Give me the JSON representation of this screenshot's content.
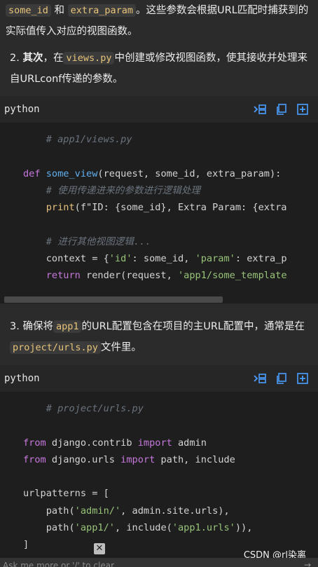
{
  "paragraph_top": {
    "code1": "some_id",
    "and": "和",
    "code2": "extra_param",
    "rest": "。这些参数会根据URL匹配时捕获到的实际值传入对应的视图函数。"
  },
  "step2": {
    "number": "2.",
    "bold": "其次",
    "text1": "，在",
    "code": "views.py",
    "text2": "中创建或修改视图函数，使其接收并处理来自URLconf传递的参数。"
  },
  "code_block_1": {
    "language": "python",
    "lines": {
      "l1": "# app1/views.py",
      "l3_kw": "def",
      "l3_fn": "some_view",
      "l3_rest": "(request, some_id, extra_param):",
      "l4": "# 使用传递进来的参数进行逻辑处理",
      "l5_fn": "print",
      "l5_rest": "(f\"ID: {some_id}, Extra Param: {extra",
      "l7": "# 进行其他视图逻辑...",
      "l8_a": "context = {",
      "l8_s1": "'id'",
      "l8_b": ": some_id, ",
      "l8_s2": "'param'",
      "l8_c": ": extra_p",
      "l9_kw": "return",
      "l9_a": " render(request, ",
      "l9_s": "'app1/some_template"
    }
  },
  "step3": {
    "number": "3.",
    "text1": "确保将",
    "code1": "app1",
    "text2": "的URL配置包含在项目的主URL配置中，通常是在",
    "code2": "project/urls.py",
    "text3": "文件里。"
  },
  "code_block_2": {
    "language": "python",
    "lines": {
      "l1": "# project/urls.py",
      "l3_kw1": "from",
      "l3_mod": " django.contrib ",
      "l3_kw2": "import",
      "l3_rest": " admin",
      "l4_kw1": "from",
      "l4_mod": " django.urls ",
      "l4_kw2": "import",
      "l4_rest": " path, include",
      "l6": "urlpatterns = [",
      "l7_a": "path(",
      "l7_s": "'admin/'",
      "l7_b": ", admin.site.urls),",
      "l8_a": "path(",
      "l8_s1": "'app1/'",
      "l8_b": ", include(",
      "l8_s2": "'app1.urls'",
      "l8_c": ")),",
      "l9": "]"
    }
  },
  "overlay": {
    "close_label": "✕",
    "watermark": "CSDN @rl染离",
    "ask_placeholder": "Ask me more or '/' to clear",
    "send_arrow": "→"
  },
  "icons": [
    "insert-icon",
    "copy-icon",
    "new-file-icon",
    "close-icon"
  ],
  "colors": {
    "accent_icon": "#4a9eff",
    "code_bg": "#1e1e1e",
    "page_bg": "#2b2b2b"
  }
}
